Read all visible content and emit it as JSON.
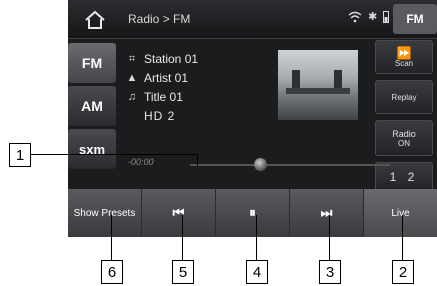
{
  "header": {
    "breadcrumb": "Radio > FM",
    "source_badge": "FM"
  },
  "tabs": [
    {
      "label": "FM"
    },
    {
      "label": "AM"
    },
    {
      "label": "sxm"
    }
  ],
  "now_playing": {
    "station": "Station 01",
    "artist": "Artist 01",
    "title": "Title 01",
    "hd": "HD 2"
  },
  "right_buttons": {
    "scan_label": "Scan",
    "replay_label": "Replay",
    "radio_label": "Radio",
    "radio_state": "ON",
    "presets_numbers": "1 2"
  },
  "progress": {
    "time": "-00:00",
    "position_fraction": 0.35
  },
  "bottom_bar": {
    "show_presets_label": "Show Presets",
    "live_label": "Live"
  },
  "callouts": [
    "1",
    "2",
    "3",
    "4",
    "5",
    "6"
  ]
}
